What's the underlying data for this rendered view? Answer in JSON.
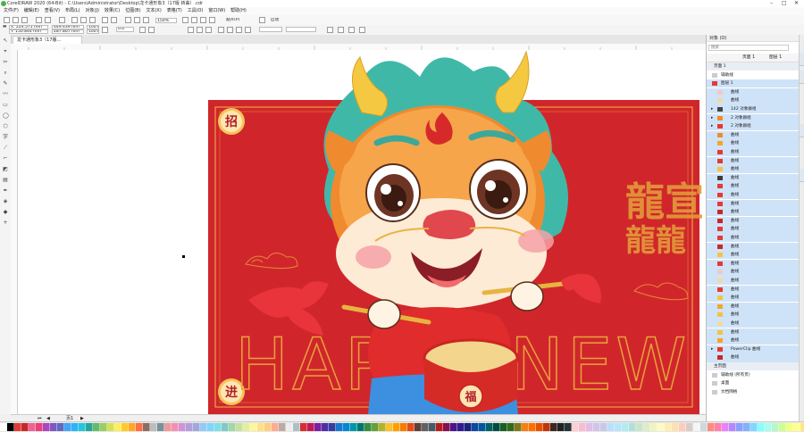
{
  "window": {
    "title": "CorelDRAW 2020 (64-Bit) - C:\\Users\\Administrator\\Desktop\\龙卡通形象3（17版 转曲）.cdr"
  },
  "menu": [
    "文件(F)",
    "编辑(E)",
    "查看(V)",
    "布局(L)",
    "对象(J)",
    "效果(C)",
    "位图(B)",
    "文本(X)",
    "表格(T)",
    "工具(O)",
    "窗口(W)",
    "帮助(H)"
  ],
  "toolbar": {
    "zoom": "150%",
    "snap": "贴齐(P)",
    "launch": "启动"
  },
  "properties": {
    "x": "X: 224.571 mm",
    "y": "Y: 150.844 mm",
    "w": "449.439 mm",
    "h": "287.867 mm",
    "sx": "100.0",
    "sy": "100.0",
    "angle": "0.0"
  },
  "document": {
    "tab": "龙卡通形象3（17版...",
    "page": "页1"
  },
  "artwork": {
    "badge_top": "招",
    "badge_bottom": "进",
    "happy_text": "HAPPY NEW",
    "right_top": "龍宣",
    "right_bottom": "龍龍",
    "drum_char": "福"
  },
  "objects_panel": {
    "title": "对象 (O)",
    "search": "搜索",
    "page_tab": "页面 1",
    "layer_tab": "图层 1",
    "items": [
      {
        "label": "页面 1",
        "type": "page",
        "color": ""
      },
      {
        "label": "辅助线",
        "type": "layer",
        "color": "#cccccc"
      },
      {
        "label": "图层 1",
        "type": "layer-sel",
        "color": "#e53935"
      },
      {
        "label": "曲线",
        "type": "item",
        "color": "#f5c6c6"
      },
      {
        "label": "曲线",
        "type": "item",
        "color": "#f3d9a0"
      },
      {
        "label": "142 对象群组",
        "type": "group",
        "color": "#444444"
      },
      {
        "label": "2 对象群组",
        "type": "group",
        "color": "#f08c2a"
      },
      {
        "label": "2 对象群组",
        "type": "group",
        "color": "#e53935"
      },
      {
        "label": "曲线",
        "type": "item",
        "color": "#f08c2a"
      },
      {
        "label": "曲线",
        "type": "item",
        "color": "#f6a623"
      },
      {
        "label": "曲线",
        "type": "item",
        "color": "#e53935"
      },
      {
        "label": "曲线",
        "type": "item",
        "color": "#e53935"
      },
      {
        "label": "曲线",
        "type": "item",
        "color": "#f5c242"
      },
      {
        "label": "曲线",
        "type": "item",
        "color": "#3c3c3c"
      },
      {
        "label": "曲线",
        "type": "item",
        "color": "#e53935"
      },
      {
        "label": "曲线",
        "type": "item",
        "color": "#e53935"
      },
      {
        "label": "曲线",
        "type": "item",
        "color": "#e53935"
      },
      {
        "label": "曲线",
        "type": "item",
        "color": "#c62828"
      },
      {
        "label": "曲线",
        "type": "item",
        "color": "#c62828"
      },
      {
        "label": "曲线",
        "type": "item",
        "color": "#e53935"
      },
      {
        "label": "曲线",
        "type": "item",
        "color": "#e53935"
      },
      {
        "label": "曲线",
        "type": "item",
        "color": "#c62828"
      },
      {
        "label": "曲线",
        "type": "item",
        "color": "#f5c242"
      },
      {
        "label": "曲线",
        "type": "item",
        "color": "#e53935"
      },
      {
        "label": "曲线",
        "type": "item",
        "color": "#f5c6c6"
      },
      {
        "label": "曲线",
        "type": "item",
        "color": "#f3d9a0"
      },
      {
        "label": "曲线",
        "type": "item",
        "color": "#e53935"
      },
      {
        "label": "曲线",
        "type": "item",
        "color": "#f5c242"
      },
      {
        "label": "曲线",
        "type": "item",
        "color": "#f6a623"
      },
      {
        "label": "曲线",
        "type": "item",
        "color": "#f5c242"
      },
      {
        "label": "曲线",
        "type": "item",
        "color": "#f3d9a0"
      },
      {
        "label": "曲线",
        "type": "item",
        "color": "#f5c242"
      },
      {
        "label": "曲线",
        "type": "item",
        "color": "#f6a623"
      },
      {
        "label": "PowerClip 曲线",
        "type": "group",
        "color": "#e53935"
      },
      {
        "label": "曲线",
        "type": "item",
        "color": "#c62828"
      },
      {
        "label": "主页面",
        "type": "page",
        "color": ""
      },
      {
        "label": "辅助线 (所有页)",
        "type": "layer",
        "color": "#cccccc"
      },
      {
        "label": "桌面",
        "type": "layer",
        "color": "#cccccc"
      },
      {
        "label": "文档网格",
        "type": "layer",
        "color": "#cccccc"
      }
    ]
  },
  "palette": [
    "#ffffff",
    "#000000",
    "#e53935",
    "#c62828",
    "#f06292",
    "#ec407a",
    "#ab47bc",
    "#7e57c2",
    "#5c6bc0",
    "#42a5f5",
    "#29b6f6",
    "#26c6da",
    "#26a69a",
    "#66bb6a",
    "#9ccc65",
    "#d4e157",
    "#ffee58",
    "#ffca28",
    "#ffa726",
    "#ff7043",
    "#8d6e63",
    "#bdbdbd",
    "#78909c",
    "#ef9a9a",
    "#f48fb1",
    "#ce93d8",
    "#b39ddb",
    "#9fa8da",
    "#90caf9",
    "#81d4fa",
    "#80deea",
    "#80cbc4",
    "#a5d6a7",
    "#c5e1a5",
    "#e6ee9c",
    "#fff59d",
    "#ffe082",
    "#ffcc80",
    "#ffab91",
    "#bcaaa4",
    "#eeeeee",
    "#b0bec5",
    "#d32f2f",
    "#c2185b",
    "#7b1fa2",
    "#512da8",
    "#303f9f",
    "#1976d2",
    "#0288d1",
    "#0097a7",
    "#00796b",
    "#388e3c",
    "#689f38",
    "#afb42b",
    "#fbc02d",
    "#ffa000",
    "#f57c00",
    "#e64a19",
    "#5d4037",
    "#616161",
    "#455a64",
    "#b71c1c",
    "#880e4f",
    "#4a148c",
    "#311b92",
    "#1a237e",
    "#0d47a1",
    "#01579b",
    "#006064",
    "#004d40",
    "#1b5e20",
    "#33691e",
    "#827717",
    "#f57f17",
    "#ff6f00",
    "#e65100",
    "#bf360c",
    "#3e2723",
    "#212121",
    "#263238",
    "#ffcdd2",
    "#f8bbd0",
    "#e1bee7",
    "#d1c4e9",
    "#c5cae9",
    "#bbdefb",
    "#b3e5fc",
    "#b2ebf2",
    "#b2dfdb",
    "#c8e6c9",
    "#dcedc8",
    "#f0f4c3",
    "#fff9c4",
    "#ffecb3",
    "#ffe0b2",
    "#ffccbc",
    "#d7ccc8",
    "#f5f5f5",
    "#cfd8dc",
    "#ff8a80",
    "#ff80ab",
    "#ea80fc",
    "#b388ff",
    "#8c9eff",
    "#82b1ff",
    "#80d8ff",
    "#84ffff",
    "#a7ffeb",
    "#b9f6ca",
    "#ccff90",
    "#f4ff81",
    "#ffff8d",
    "#ffe57f",
    "#ffd180",
    "#ff9e80",
    "#a1887f",
    "#9e9e9e",
    "#90a4ae",
    "#ff5252",
    "#ff4081",
    "#e040fb",
    "#7c4dff",
    "#536dfe",
    "#448aff",
    "#40c4ff",
    "#18ffff",
    "#64ffda",
    "#69f0ae"
  ]
}
